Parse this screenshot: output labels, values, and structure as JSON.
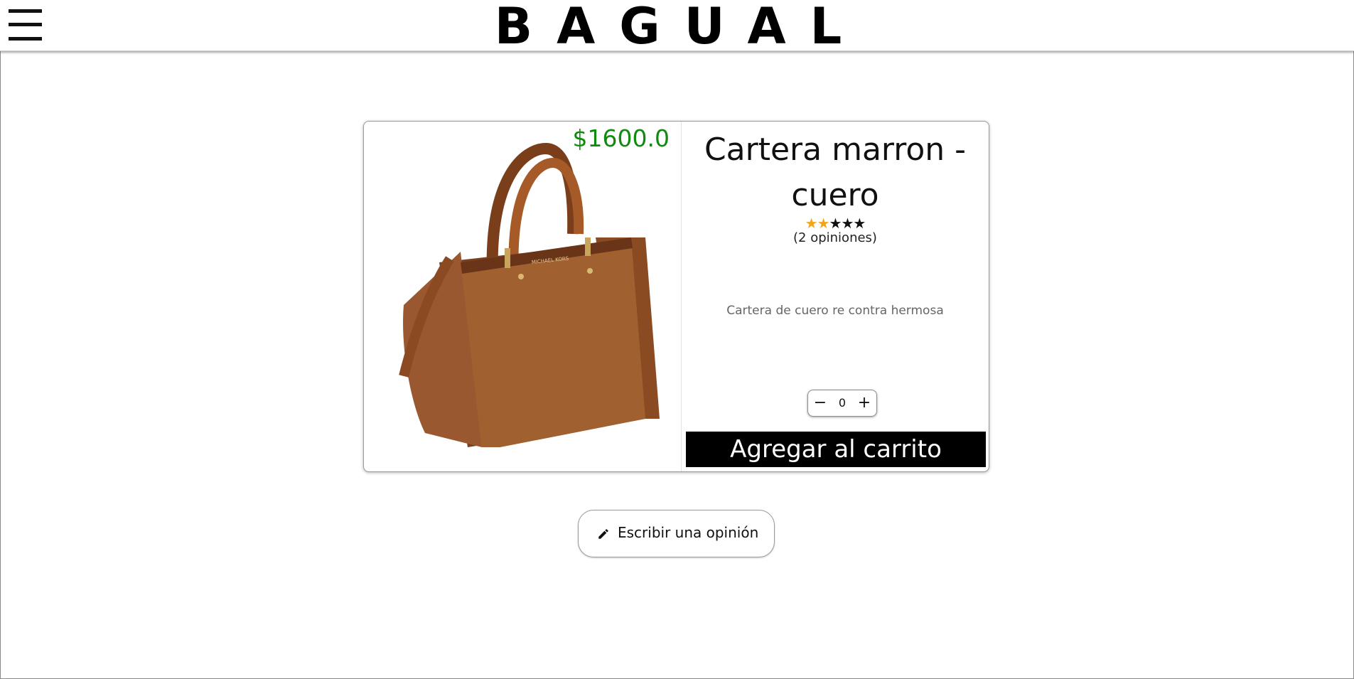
{
  "header": {
    "menu_icon": "hamburger-menu-icon",
    "brand": "BAGUAL"
  },
  "product": {
    "price": "$1600.0",
    "title": "Cartera marron - cuero",
    "rating": {
      "value": 2,
      "max": 5,
      "filled_color": "#f2a51a",
      "empty_color": "#111111"
    },
    "reviews_text": "(2 opiniones)",
    "description": "Cartera de cuero re contra hermosa",
    "quantity": "0",
    "minus_icon": "minus-icon",
    "plus_icon": "plus-icon",
    "add_to_cart_label": "Agregar al carrito",
    "image_logo_text": "MICHAEL KORS"
  },
  "review_button": {
    "icon": "pencil-icon",
    "label": "Escribir una opinión"
  },
  "colors": {
    "price": "#118a11",
    "cta_bg": "#000000",
    "cta_text": "#ffffff"
  }
}
